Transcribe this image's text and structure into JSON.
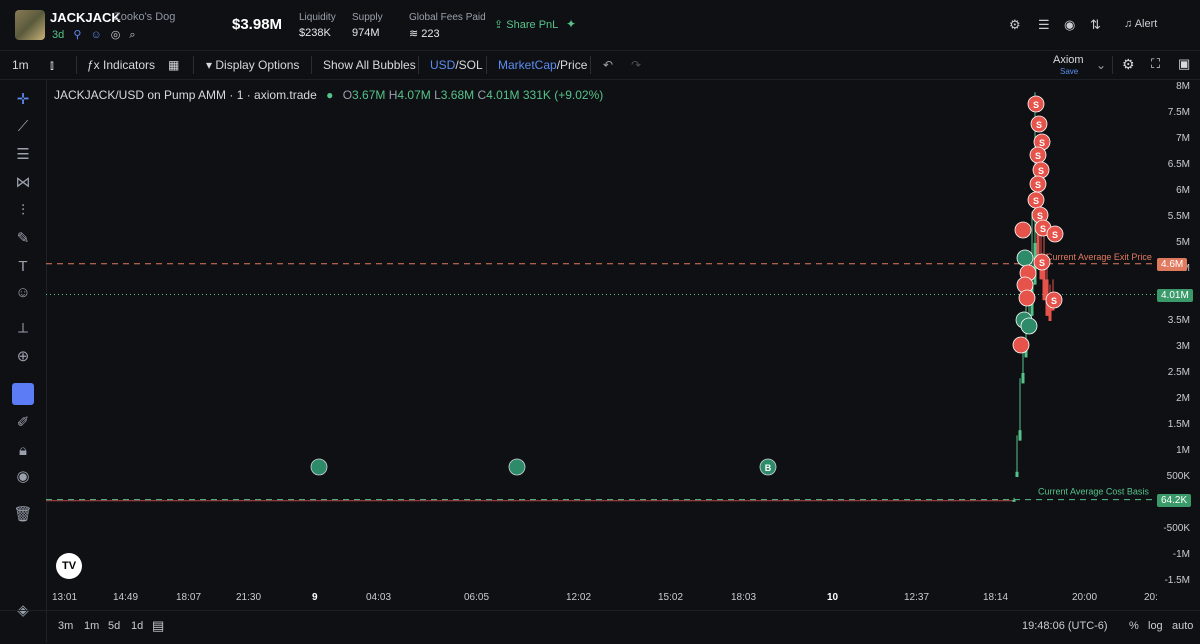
{
  "token": {
    "symbol": "JACKJACK",
    "name": "Zooko's Dog",
    "age": "3d"
  },
  "price": "$3.98M",
  "stats": {
    "liquidity_label": "Liquidity",
    "liquidity": "$238K",
    "supply_label": "Supply",
    "supply": "974M",
    "fees_label": "Global Fees Paid",
    "fees": "223"
  },
  "share_label": "Share PnL",
  "alert_label": "Alert",
  "toolbar": {
    "interval": "1m",
    "indicators": "Indicators",
    "display_options": "Display Options",
    "show_bubbles": "Show All Bubbles",
    "usd": "USD",
    "sol": "/SOL",
    "marketcap": "MarketCap",
    "price": "/Price",
    "layout_name": "Axiom",
    "save": "Save"
  },
  "legend": {
    "title": "JACKJACK/USD on Pump AMM · 1 · axiom.trade",
    "o_label": "O",
    "o": "3.67M",
    "h_label": "H",
    "h": "4.07M",
    "l_label": "L",
    "l": "3.68M",
    "c_label": "C",
    "c": "4.01M",
    "change": "331K (+9.02%)"
  },
  "chart_data": {
    "type": "line",
    "y_ticks": [
      "8M",
      "7.5M",
      "7M",
      "6.5M",
      "6M",
      "5.5M",
      "5M",
      "4.5M",
      "4M",
      "3.5M",
      "3M",
      "2.5M",
      "2M",
      "1.5M",
      "1M",
      "500K",
      "0",
      "-500K",
      "-1M",
      "-1.5M"
    ],
    "x_ticks": [
      "13:01",
      "14:49",
      "18:07",
      "21:30",
      "9",
      "04:03",
      "06:05",
      "12:02",
      "15:02",
      "18:03",
      "10",
      "12:37",
      "18:14",
      "20:00",
      "20:"
    ],
    "lines": {
      "exit_label": "Current Average Exit Price",
      "exit_value": "4.6M",
      "cost_label": "Current Average Cost Basis",
      "cost_value": "64.2K",
      "current_value": "4.01M"
    },
    "ylim": [
      -1500000,
      8000000
    ],
    "series": [
      {
        "x": [
          0,
          0.4,
          0.9
        ],
        "y": [
          64000,
          64000,
          64000
        ]
      },
      {
        "x": [
          0.9,
          0.905,
          0.91,
          0.915,
          0.92,
          0.925,
          0.93,
          0.935
        ],
        "y": [
          64000,
          700000,
          1800000,
          3000000,
          3800000,
          5200000,
          4600000,
          4010000
        ]
      }
    ]
  },
  "bubbles": {
    "buy": "B",
    "sell": "S"
  },
  "bottom": {
    "r3m": "3m",
    "r1m": "1m",
    "r5d": "5d",
    "r1d": "1d",
    "time": "19:48:06 (UTC-6)",
    "pct": "%",
    "log": "log",
    "auto": "auto"
  },
  "colors": {
    "up": "#56c28a",
    "down": "#e5534b",
    "exit": "#e07a5f",
    "accent": "#5b8def"
  }
}
